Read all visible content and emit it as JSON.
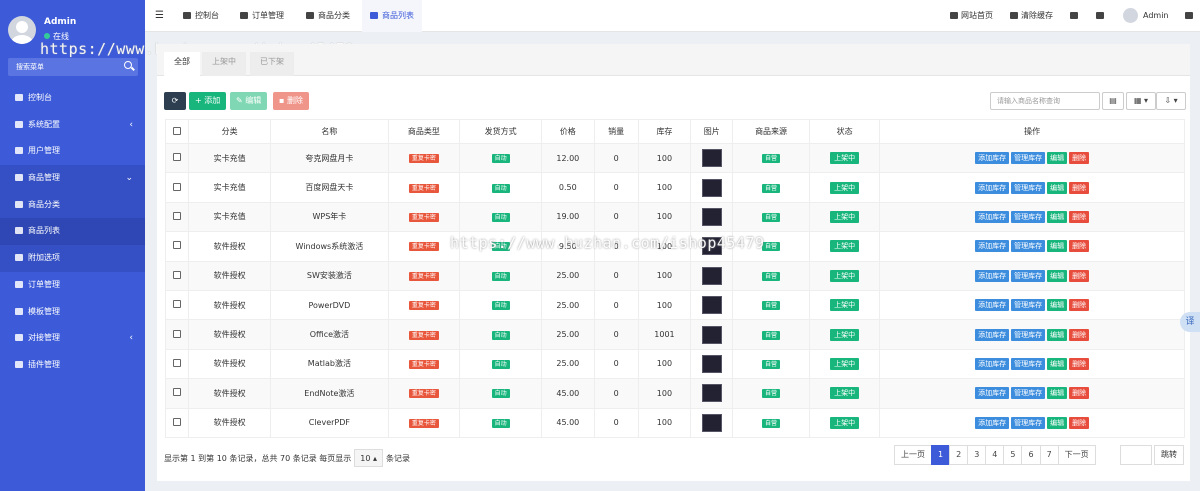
{
  "user": {
    "name": "Admin",
    "status": "在线"
  },
  "sidebar": {
    "search_label": "搜索菜单",
    "items": [
      {
        "label": "控制台",
        "arrow": ""
      },
      {
        "label": "系统配置",
        "arrow": "‹"
      },
      {
        "label": "用户管理",
        "arrow": ""
      },
      {
        "label": "商品管理",
        "arrow": "⌄"
      },
      {
        "label": "商品分类",
        "arrow": ""
      },
      {
        "label": "商品列表",
        "arrow": ""
      },
      {
        "label": "附加选项",
        "arrow": ""
      },
      {
        "label": "订单管理",
        "arrow": ""
      },
      {
        "label": "模板管理",
        "arrow": ""
      },
      {
        "label": "对接管理",
        "arrow": "‹"
      },
      {
        "label": "插件管理",
        "arrow": ""
      }
    ]
  },
  "watermark": {
    "text": "https://www.huzhan.com/ishop45479"
  },
  "topnav": {
    "items": [
      "控制台",
      "订单管理",
      "商品分类",
      "商品列表"
    ],
    "home": "网站首页",
    "clear_cache": "清除缓存",
    "admin": "Admin"
  },
  "tabs": [
    "全部",
    "上架中",
    "已下架"
  ],
  "toolbar": {
    "add": "添加",
    "edit": "编辑",
    "delete": "删除",
    "search_placeholder": "请输入商品名称查询"
  },
  "table": {
    "headers": [
      "分类",
      "名称",
      "商品类型",
      "发货方式",
      "价格",
      "销量",
      "库存",
      "图片",
      "商品来源",
      "状态",
      "操作"
    ],
    "type_badge": "重复卡密",
    "ship_badge": "自动",
    "source_badge": "自营",
    "status_badge": "上架中",
    "actions": [
      "添加库存",
      "管理库存",
      "编辑",
      "删除"
    ],
    "rows": [
      {
        "category": "实卡充值",
        "name": "夸克网盘月卡",
        "price": "12.00",
        "sales": "0",
        "stock": "100"
      },
      {
        "category": "实卡充值",
        "name": "百度网盘天卡",
        "price": "0.50",
        "sales": "0",
        "stock": "100"
      },
      {
        "category": "实卡充值",
        "name": "WPS年卡",
        "price": "19.00",
        "sales": "0",
        "stock": "100"
      },
      {
        "category": "软件授权",
        "name": "Windows系统激活",
        "price": "9.50",
        "sales": "0",
        "stock": "100"
      },
      {
        "category": "软件授权",
        "name": "SW安装激活",
        "price": "25.00",
        "sales": "0",
        "stock": "100"
      },
      {
        "category": "软件授权",
        "name": "PowerDVD",
        "price": "25.00",
        "sales": "0",
        "stock": "100"
      },
      {
        "category": "软件授权",
        "name": "Office激活",
        "price": "25.00",
        "sales": "0",
        "stock": "1001"
      },
      {
        "category": "软件授权",
        "name": "Matlab激活",
        "price": "25.00",
        "sales": "0",
        "stock": "100"
      },
      {
        "category": "软件授权",
        "name": "EndNote激活",
        "price": "45.00",
        "sales": "0",
        "stock": "100"
      },
      {
        "category": "软件授权",
        "name": "CleverPDF",
        "price": "45.00",
        "sales": "0",
        "stock": "100"
      }
    ]
  },
  "pagination": {
    "info_prefix": "显示第 1 到第 10 条记录，总共 70 条记录 每页显示",
    "page_size": "10",
    "info_suffix": "条记录",
    "prev": "上一页",
    "pages": [
      "1",
      "2",
      "3",
      "4",
      "5",
      "6",
      "7"
    ],
    "next": "下一页",
    "jump": "跳转"
  },
  "translate": "译"
}
